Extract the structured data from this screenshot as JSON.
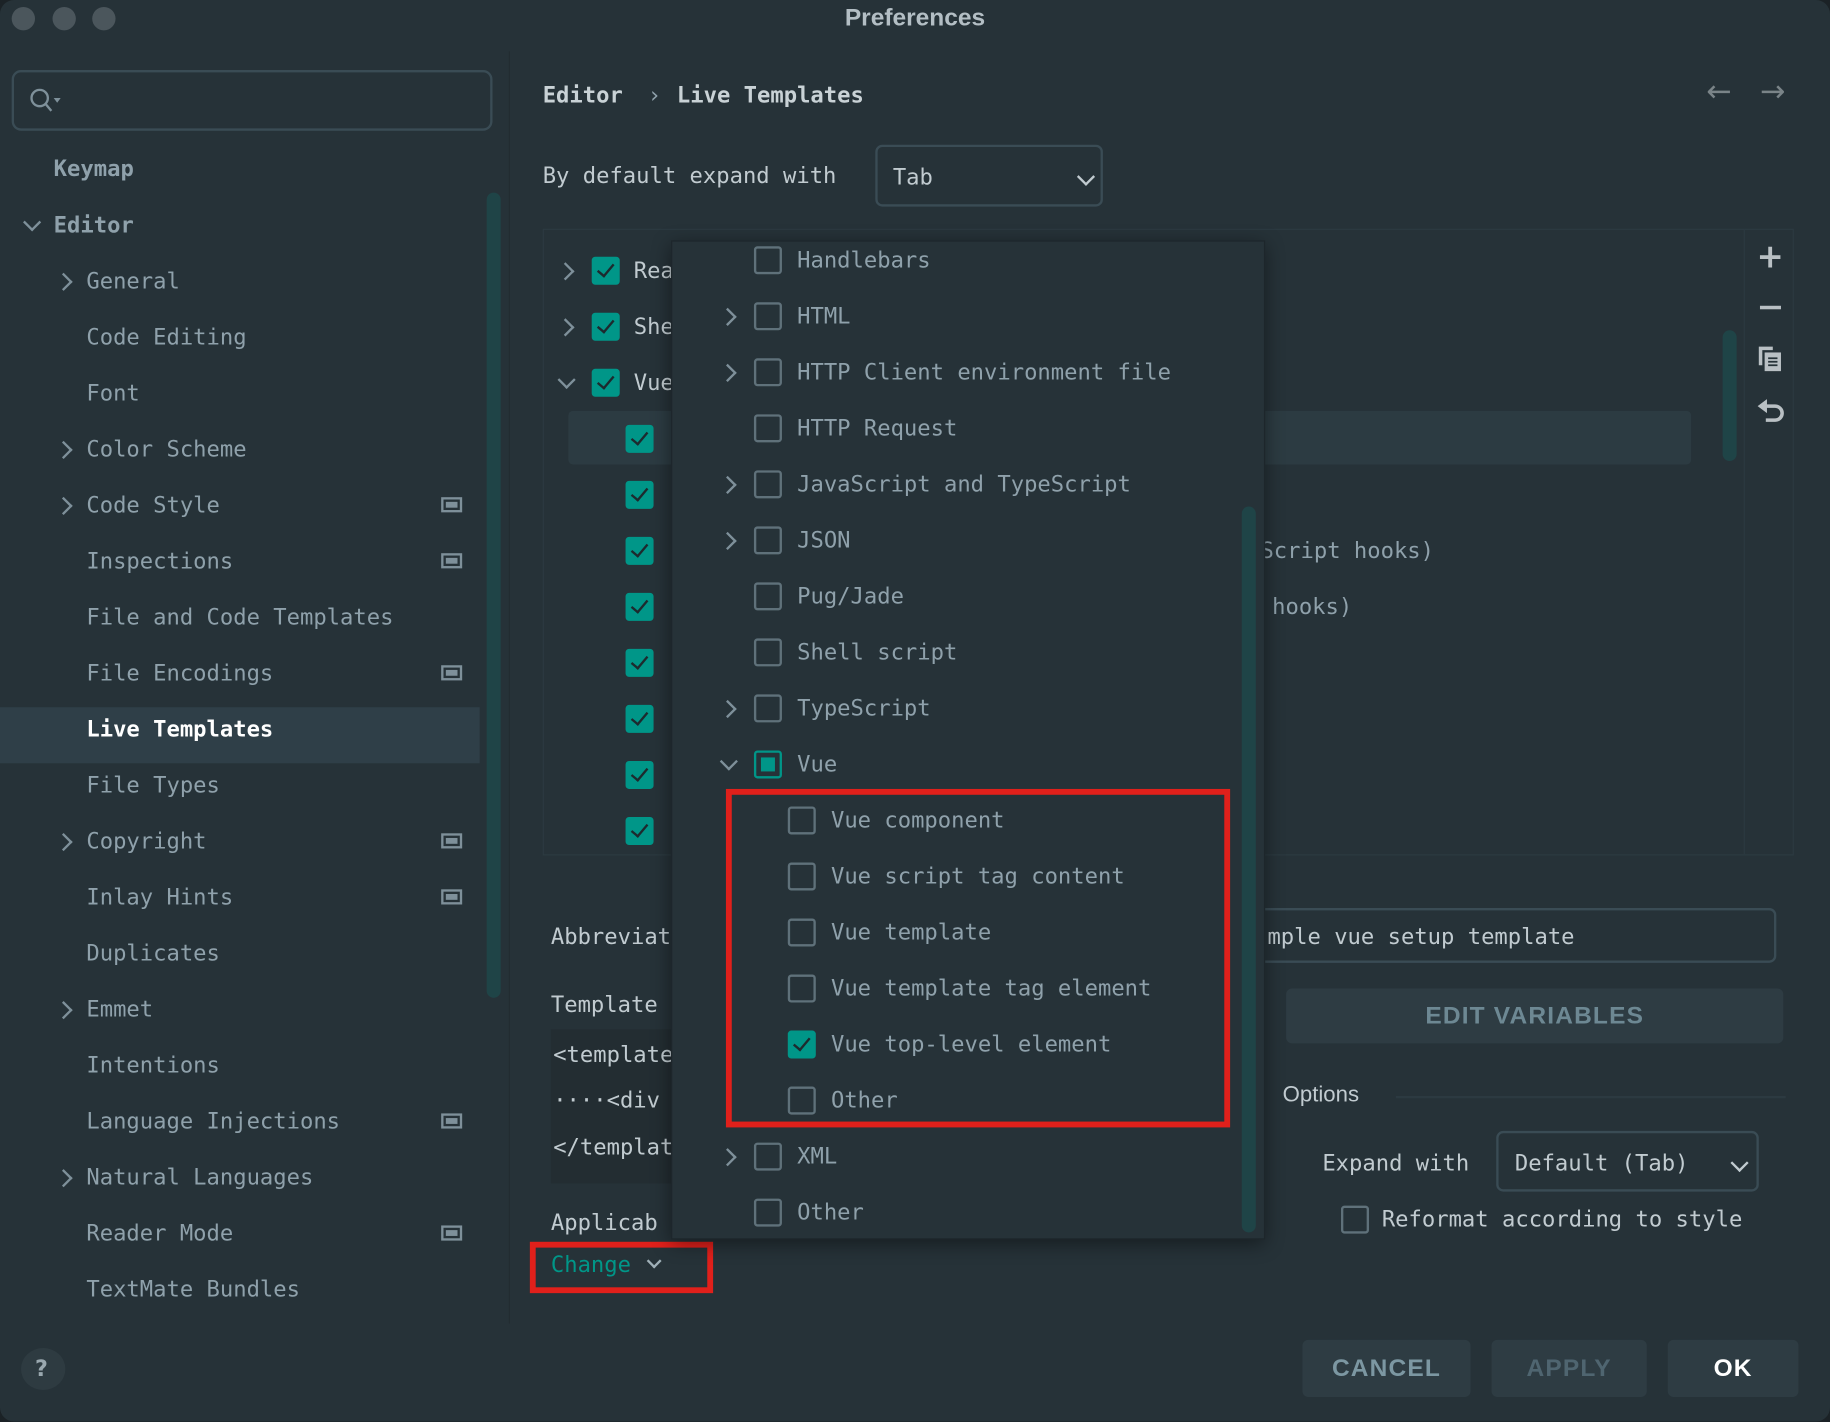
{
  "window": {
    "title": "Preferences"
  },
  "colors": {
    "background": "#263238",
    "accent": "#009688",
    "selection": "#2f3f48",
    "highlight_box": "#e0201b"
  },
  "search": {
    "placeholder": "",
    "icon": "search-icon"
  },
  "sidebar": {
    "items": [
      {
        "label": "Keymap",
        "level": 0,
        "chevron": "none",
        "project_icon": false
      },
      {
        "label": "Editor",
        "level": 0,
        "chevron": "down",
        "project_icon": false
      },
      {
        "label": "General",
        "level": 1,
        "chevron": "right",
        "project_icon": false
      },
      {
        "label": "Code Editing",
        "level": 1,
        "chevron": "none",
        "project_icon": false
      },
      {
        "label": "Font",
        "level": 1,
        "chevron": "none",
        "project_icon": false
      },
      {
        "label": "Color Scheme",
        "level": 1,
        "chevron": "right",
        "project_icon": false
      },
      {
        "label": "Code Style",
        "level": 1,
        "chevron": "right",
        "project_icon": true
      },
      {
        "label": "Inspections",
        "level": 1,
        "chevron": "none",
        "project_icon": true
      },
      {
        "label": "File and Code Templates",
        "level": 1,
        "chevron": "none",
        "project_icon": false
      },
      {
        "label": "File Encodings",
        "level": 1,
        "chevron": "none",
        "project_icon": true
      },
      {
        "label": "Live Templates",
        "level": 1,
        "chevron": "none",
        "project_icon": false,
        "selected": true
      },
      {
        "label": "File Types",
        "level": 1,
        "chevron": "none",
        "project_icon": false
      },
      {
        "label": "Copyright",
        "level": 1,
        "chevron": "right",
        "project_icon": true
      },
      {
        "label": "Inlay Hints",
        "level": 1,
        "chevron": "none",
        "project_icon": true
      },
      {
        "label": "Duplicates",
        "level": 1,
        "chevron": "none",
        "project_icon": false
      },
      {
        "label": "Emmet",
        "level": 1,
        "chevron": "right",
        "project_icon": false
      },
      {
        "label": "Intentions",
        "level": 1,
        "chevron": "none",
        "project_icon": false
      },
      {
        "label": "Language Injections",
        "level": 1,
        "chevron": "none",
        "project_icon": true
      },
      {
        "label": "Natural Languages",
        "level": 1,
        "chevron": "right",
        "project_icon": false
      },
      {
        "label": "Reader Mode",
        "level": 1,
        "chevron": "none",
        "project_icon": true
      },
      {
        "label": "TextMate Bundles",
        "level": 1,
        "chevron": "none",
        "project_icon": false
      }
    ],
    "help_label": "?"
  },
  "header": {
    "breadcrumb": [
      "Editor",
      "Live Templates"
    ],
    "separator": "›",
    "back_icon": "arrow-left-icon",
    "forward_icon": "arrow-right-icon"
  },
  "expand_default": {
    "label": "By default expand with",
    "value": "Tab"
  },
  "tree": {
    "groups": [
      {
        "label": "Rea",
        "expanded": false,
        "state": "checked"
      },
      {
        "label": "She",
        "expanded": false,
        "state": "checked"
      },
      {
        "label": "Vue",
        "expanded": true,
        "state": "checked"
      }
    ],
    "children_states": [
      "checked",
      "checked",
      "checked",
      "checked",
      "checked",
      "checked",
      "checked",
      "checked"
    ],
    "visible_fragments": [
      "Script hooks)",
      "hooks)"
    ],
    "toolbar": [
      "add-icon",
      "remove-icon",
      "copy-icon",
      "revert-icon"
    ]
  },
  "popup": {
    "items": [
      {
        "label": "Handlebars",
        "chevron": false,
        "state": "unchecked",
        "level": 0
      },
      {
        "label": "HTML",
        "chevron": true,
        "state": "unchecked",
        "level": 0
      },
      {
        "label": "HTTP Client environment file",
        "chevron": true,
        "state": "unchecked",
        "level": 0
      },
      {
        "label": "HTTP Request",
        "chevron": false,
        "state": "unchecked",
        "level": 0
      },
      {
        "label": "JavaScript and TypeScript",
        "chevron": true,
        "state": "unchecked",
        "level": 0
      },
      {
        "label": "JSON",
        "chevron": true,
        "state": "unchecked",
        "level": 0
      },
      {
        "label": "Pug/Jade",
        "chevron": false,
        "state": "unchecked",
        "level": 0
      },
      {
        "label": "Shell script",
        "chevron": false,
        "state": "unchecked",
        "level": 0
      },
      {
        "label": "TypeScript",
        "chevron": true,
        "state": "unchecked",
        "level": 0
      },
      {
        "label": "Vue",
        "chevron": "down",
        "state": "partial",
        "level": 0
      },
      {
        "label": "Vue component",
        "chevron": false,
        "state": "unchecked",
        "level": 1
      },
      {
        "label": "Vue script tag content",
        "chevron": false,
        "state": "unchecked",
        "level": 1
      },
      {
        "label": "Vue template",
        "chevron": false,
        "state": "unchecked",
        "level": 1
      },
      {
        "label": "Vue template tag element",
        "chevron": false,
        "state": "unchecked",
        "level": 1
      },
      {
        "label": "Vue top-level element",
        "chevron": false,
        "state": "checked",
        "level": 1
      },
      {
        "label": "Other",
        "chevron": false,
        "state": "unchecked",
        "level": 1
      },
      {
        "label": "XML",
        "chevron": true,
        "state": "unchecked",
        "level": 0
      },
      {
        "label": "Other",
        "chevron": false,
        "state": "unchecked",
        "level": 0
      }
    ]
  },
  "details": {
    "abbreviation_label": "Abbreviat",
    "description_value": "mple vue setup template",
    "template_label": "Template",
    "template_lines": [
      "<template",
      "····<div",
      "</templat"
    ],
    "applicable_label": "Applicab",
    "change_label": "Change",
    "edit_variables": "EDIT VARIABLES",
    "options_label": "Options",
    "expand_with_label": "Expand with",
    "expand_with_value": "Default (Tab)",
    "reformat_label": "Reformat according to style",
    "reformat_checked": false
  },
  "footer": {
    "cancel": "CANCEL",
    "apply": "APPLY",
    "ok": "OK"
  }
}
